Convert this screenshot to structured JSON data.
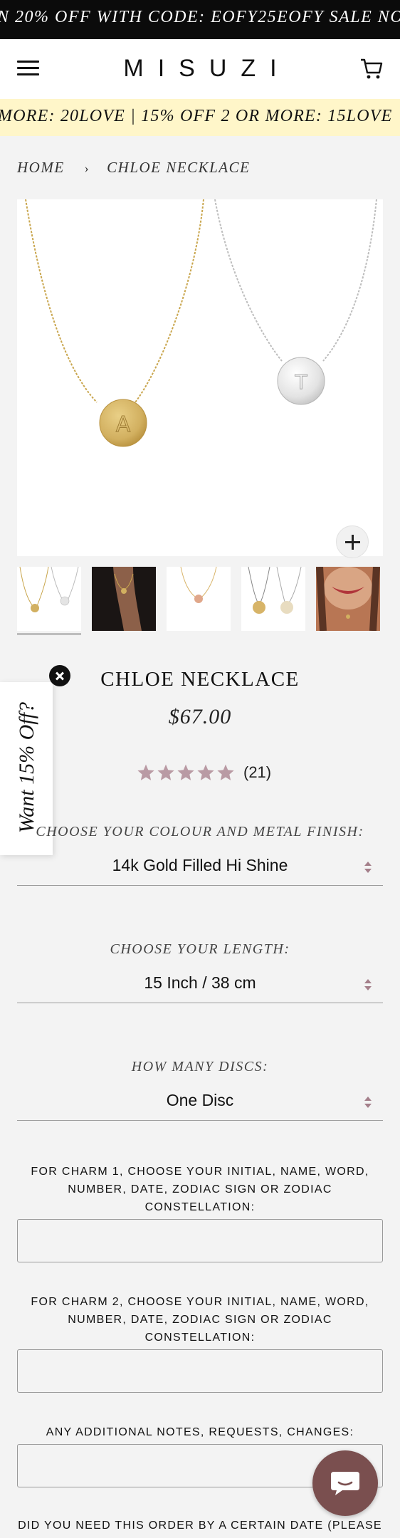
{
  "announcement": {
    "text": "N 20% OFF WITH CODE: EOFY25EOFY SALE NO"
  },
  "header": {
    "logo": "MISUZI"
  },
  "promo": {
    "text": "MORE: 20LOVE  |  15% OFF 2 OR MORE: 15LOVE"
  },
  "breadcrumb": {
    "home": "HOME",
    "separator": "›",
    "current": "CHLOE NECKLACE"
  },
  "popup": {
    "label": "Want 15% Off?"
  },
  "product": {
    "title": "CHLOE NECKLACE",
    "price": "$67.00",
    "rating_stars": 5,
    "reviews": "(21)"
  },
  "options": {
    "colour": {
      "label": "CHOOSE YOUR COLOUR AND METAL FINISH:",
      "value": "14k Gold Filled Hi Shine"
    },
    "length": {
      "label": "CHOOSE YOUR LENGTH:",
      "value": "15 Inch / 38 cm"
    },
    "discs": {
      "label": "HOW MANY DISCS:",
      "value": "One Disc"
    }
  },
  "fields": {
    "charm1": {
      "label": "FOR CHARM 1, CHOOSE YOUR INITIAL, NAME, WORD, NUMBER, DATE, ZODIAC SIGN OR ZODIAC CONSTELLATION:",
      "value": ""
    },
    "charm2": {
      "label": "FOR CHARM 2, CHOOSE YOUR INITIAL, NAME, WORD, NUMBER, DATE, ZODIAC SIGN OR ZODIAC CONSTELLATION:",
      "value": ""
    },
    "notes": {
      "label": "ANY ADDITIONAL NOTES, REQUESTS, CHANGES:",
      "value": ""
    }
  },
  "bottom_note": "DID YOU NEED THIS ORDER BY A CERTAIN DATE (PLEASE",
  "colors": {
    "announcement_bg": "#0b0b0b",
    "promo_bg": "#fff6c9",
    "star": "#b99aa4",
    "chat_bg": "#7a4f4f"
  }
}
